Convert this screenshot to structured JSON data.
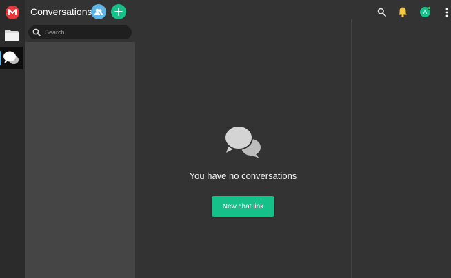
{
  "rail": {
    "logo_letter": "M",
    "items": [
      {
        "icon": "folder-icon"
      },
      {
        "icon": "chat-bubbles-icon",
        "active": true
      }
    ]
  },
  "conversations": {
    "title": "Conversations",
    "search_placeholder": "Search"
  },
  "main": {
    "empty_text": "You have no conversations",
    "new_chat_label": "New chat link"
  },
  "topbar": {
    "avatar_letter": "A"
  },
  "colors": {
    "accent_green": "#16c089",
    "accent_blue": "#5fb5e8",
    "brand_red": "#e6393d",
    "background": "#333333",
    "panel": "#454545"
  }
}
